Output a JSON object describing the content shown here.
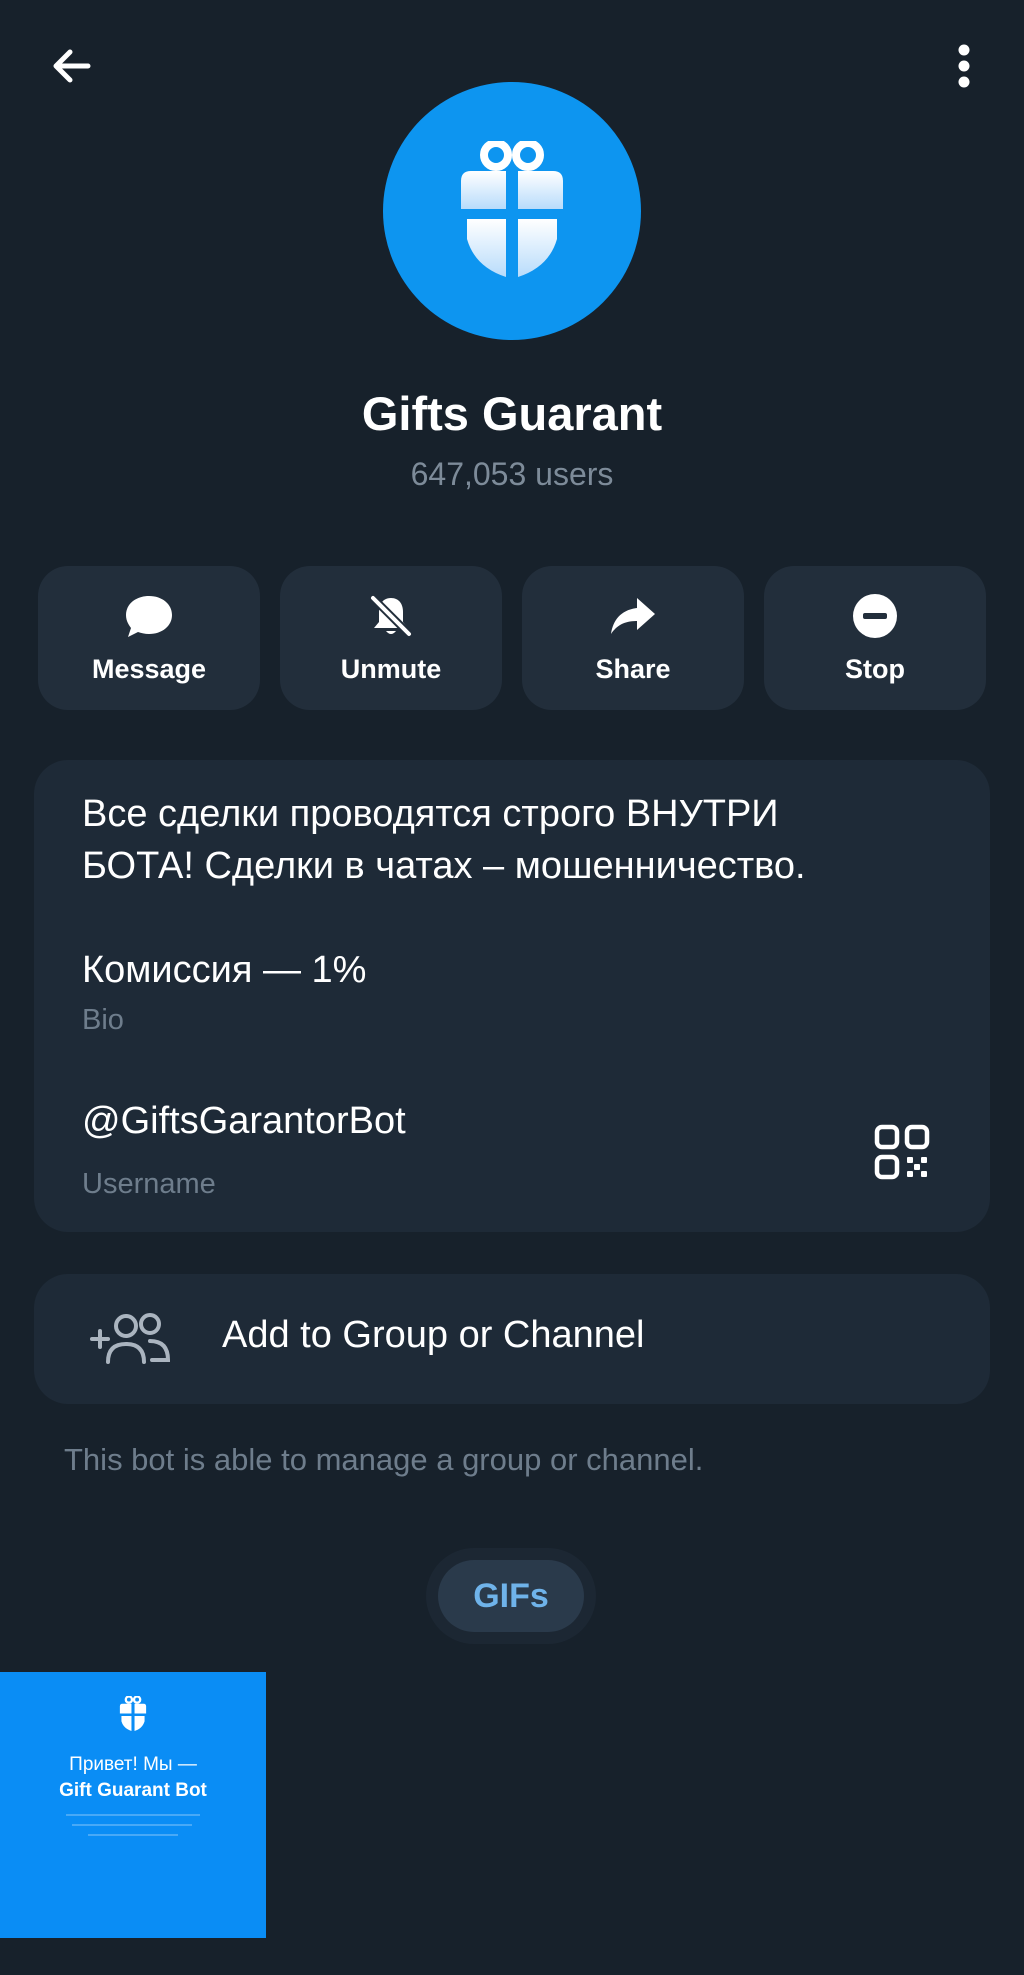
{
  "header": {
    "back_icon": "arrow-left-icon",
    "menu_icon": "more-vertical-icon"
  },
  "profile": {
    "name": "Gifts Guarant",
    "subtitle": "647,053 users",
    "avatar_icon": "gift-icon",
    "avatar_color": "#0d95f0"
  },
  "actions": [
    {
      "label": "Message",
      "icon": "message-bubble-icon"
    },
    {
      "label": "Unmute",
      "icon": "bell-off-icon"
    },
    {
      "label": "Share",
      "icon": "share-arrow-icon"
    },
    {
      "label": "Stop",
      "icon": "stop-icon"
    }
  ],
  "info": {
    "bio": "Все сделки проводятся строго ВНУТРИ\nБОТА! Сделки в чатах – мошенничество.\n\nКомиссия — 1%",
    "bio_caption": "Bio",
    "username": "@GiftsGarantorBot",
    "username_caption": "Username",
    "qr_icon": "qr-code-icon"
  },
  "add_to_group": {
    "label": "Add to Group or Channel",
    "icon": "add-users-icon",
    "helper": "This bot is able to manage a group or channel."
  },
  "media_tabs": {
    "active": "GIFs"
  },
  "gif_preview": {
    "line1": "Привет! Мы —",
    "line2": "Gift Guarant Bot",
    "background": "#0a8df5"
  },
  "colors": {
    "background": "#17212b",
    "card": "#1e2a37",
    "button": "#222e3b",
    "muted_text": "#6e7d8c",
    "accent": "#6fb3ea"
  }
}
